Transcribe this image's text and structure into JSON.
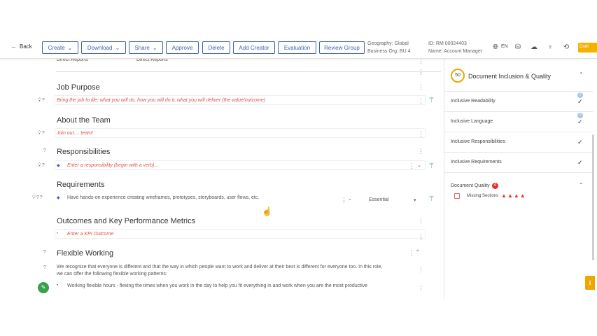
{
  "toolbar": {
    "back_label": "Back",
    "buttons": [
      {
        "label": "Create",
        "dropdown": true
      },
      {
        "label": "Download",
        "dropdown": true
      },
      {
        "label": "Share",
        "dropdown": true
      },
      {
        "label": "Approve",
        "dropdown": false
      },
      {
        "label": "Delete",
        "dropdown": false
      },
      {
        "label": "Add Creator",
        "dropdown": false
      },
      {
        "label": "Evaluation",
        "dropdown": false
      },
      {
        "label": "Review Group",
        "dropdown": false
      }
    ],
    "geography": "Geography: Global",
    "business_org": "Business Org: BU 4",
    "doc_id": "ID: RM 00024403",
    "name": "Name: Account Manager",
    "lang": "EN",
    "draft_label": "Draft"
  },
  "document": {
    "top_row": {
      "left": "Direct Reports",
      "right": "Direct Reports"
    },
    "sections": {
      "job_purpose": {
        "title": "Job Purpose",
        "placeholder": "Bring the job to life: what you will do, how you will do it, what you will deliver (the value/outcome)"
      },
      "about_team": {
        "title": "About the Team",
        "placeholder": "Join our.... team!"
      },
      "responsibilities": {
        "title": "Responsibilities",
        "placeholder": "Enter a responsibility (begin with a verb)..."
      },
      "requirements": {
        "title": "Requirements",
        "item": "Have hands-on experience creating wireframes, prototypes, storyboards, user flows, etc.",
        "level": "Essential"
      },
      "outcomes": {
        "title": "Outcomes and Key Performance Metrics",
        "placeholder": "Enter a KPI Outcome"
      },
      "flexible": {
        "title": "Flexible Working",
        "text_1": "We recognize that everyone is different and that the way in which people want to work and deliver at their best is different for everyone too. In this role,",
        "text_2": "we can offer the following flexible working patterns:",
        "item": "Working flexible hours - flexing the times when you work in the day to help you fit everything in and work when you are the most productive"
      }
    }
  },
  "panel": {
    "score": "50",
    "title": "Document Inclusion & Quality",
    "items": [
      {
        "label": "Inclusive Readability"
      },
      {
        "label": "Inclusive Language"
      },
      {
        "label": "Inclusive Responsibilities"
      },
      {
        "label": "Inclusive Requirements"
      }
    ],
    "quality": {
      "label": "Document Quality",
      "badge": "4",
      "missing_label": "Missing Sections"
    }
  },
  "colors": {
    "accent": "#3f63b5",
    "hint_red": "#d9534f",
    "success_green": "#3aa14a",
    "warning_orange": "#f0a500"
  }
}
